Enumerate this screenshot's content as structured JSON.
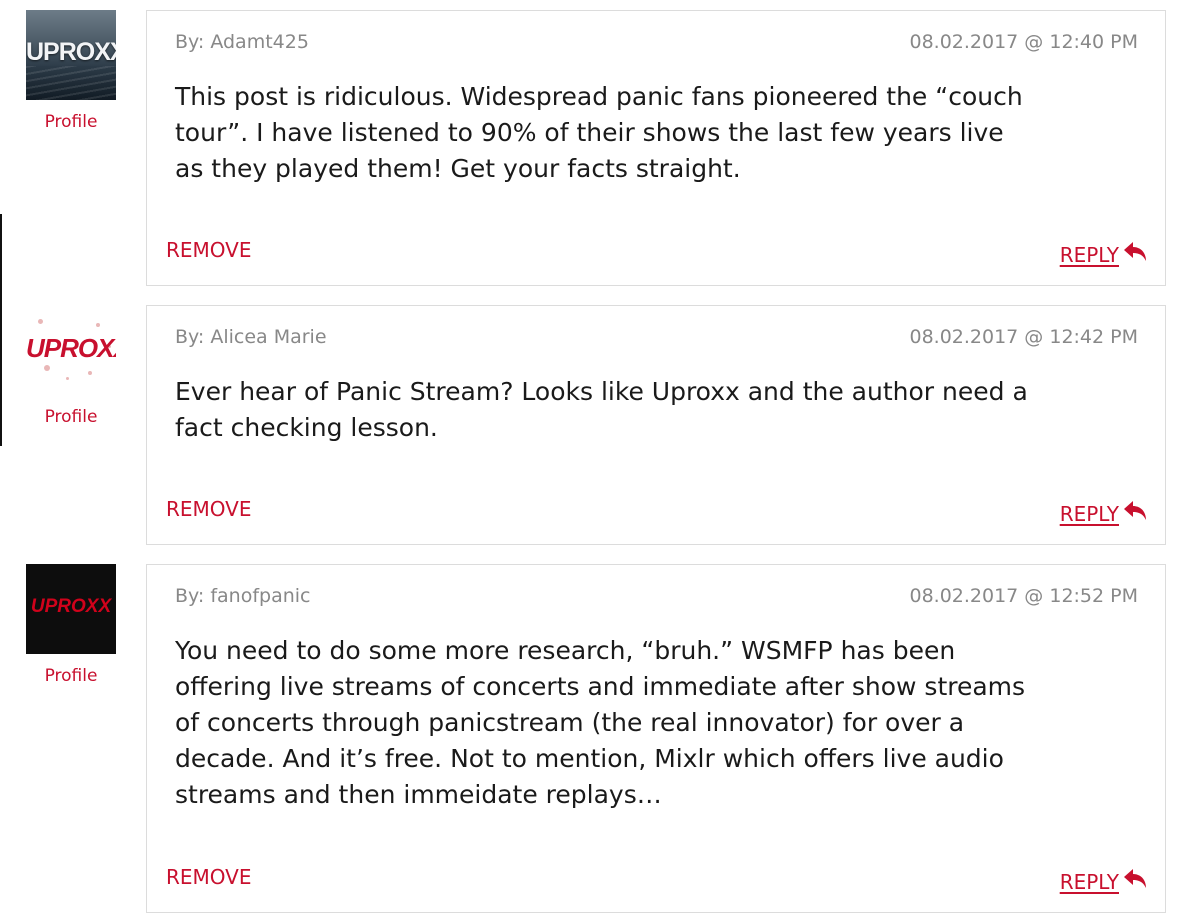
{
  "comments": [
    {
      "avatar": {
        "style": "photo",
        "logo_text": "UPROXX"
      },
      "profile_label": "Profile",
      "byline": "By: Adamt425",
      "timestamp": "08.02.2017 @ 12:40 PM",
      "text": "This post is ridiculous. Widespread panic fans pioneered the “couch\ntour”. I have listened to 90% of their shows the last few years live\nas they played them! Get your facts straight.",
      "remove_label": "REMOVE",
      "reply_label": "REPLY"
    },
    {
      "avatar": {
        "style": "red-splatter",
        "logo_text": "UPROXX"
      },
      "profile_label": "Profile",
      "byline": "By: Alicea Marie",
      "timestamp": "08.02.2017 @ 12:42 PM",
      "text": "Ever hear of Panic Stream? Looks like Uproxx and the author need a\nfact checking lesson.",
      "remove_label": "REMOVE",
      "reply_label": "REPLY"
    },
    {
      "avatar": {
        "style": "black-metal",
        "logo_text": "UPROXX"
      },
      "profile_label": "Profile",
      "byline": "By: fanofpanic",
      "timestamp": "08.02.2017 @ 12:52 PM",
      "text": "You need to do some more research, “bruh.” WSMFP has been\noffering live streams of concerts and immediate after show streams\nof concerts through panicstream (the real innovator) for over a\ndecade. And it’s free. Not to mention, Mixlr which offers live audio\nstreams and then immeidate replays…",
      "remove_label": "REMOVE",
      "reply_label": "REPLY"
    }
  ],
  "icons": {
    "reply": "reply-arrow-icon"
  },
  "colors": {
    "accent": "#c8102e",
    "meta_text": "#888888",
    "body_text": "#1a1a1a",
    "card_border": "#dcdcdc"
  }
}
